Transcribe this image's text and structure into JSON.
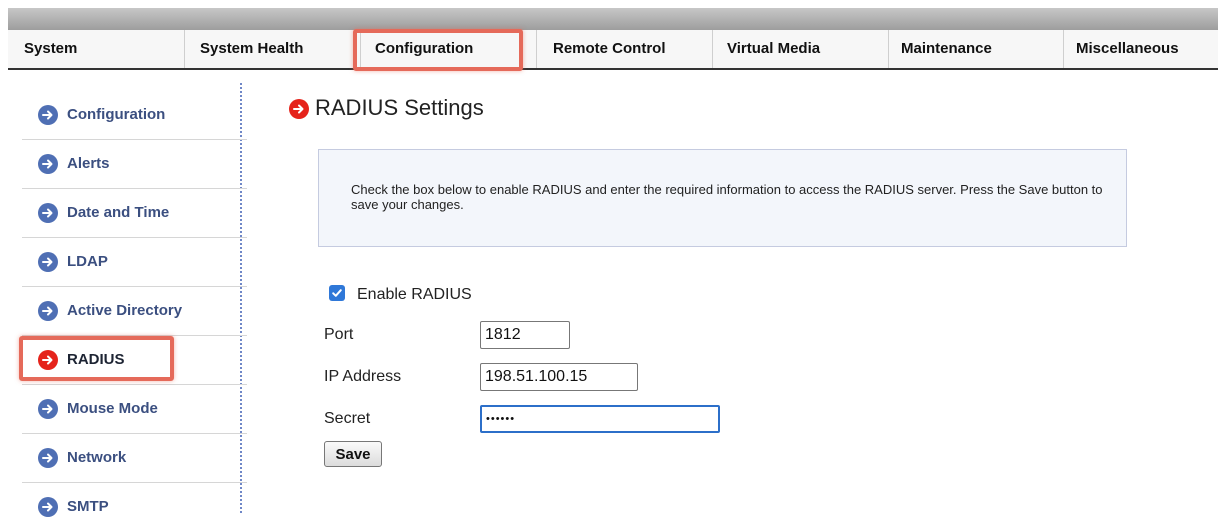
{
  "nav": {
    "items": [
      {
        "label": "System"
      },
      {
        "label": "System Health"
      },
      {
        "label": "Configuration"
      },
      {
        "label": "Remote Control"
      },
      {
        "label": "Virtual Media"
      },
      {
        "label": "Maintenance"
      },
      {
        "label": "Miscellaneous"
      }
    ],
    "active": "Configuration"
  },
  "sidebar": {
    "items": [
      {
        "label": "Configuration",
        "icon": "arrow-right-circle-icon"
      },
      {
        "label": "Alerts",
        "icon": "arrow-right-circle-icon"
      },
      {
        "label": "Date and Time",
        "icon": "arrow-right-circle-icon"
      },
      {
        "label": "LDAP",
        "icon": "arrow-right-circle-icon"
      },
      {
        "label": "Active Directory",
        "icon": "arrow-right-circle-icon"
      },
      {
        "label": "RADIUS",
        "icon": "arrow-right-circle-icon",
        "active": true
      },
      {
        "label": "Mouse Mode",
        "icon": "arrow-right-circle-icon"
      },
      {
        "label": "Network",
        "icon": "arrow-right-circle-icon"
      },
      {
        "label": "SMTP",
        "icon": "arrow-right-circle-icon"
      }
    ]
  },
  "main": {
    "title": "RADIUS Settings",
    "info": "Check the box below to enable RADIUS and enter the required information to access the RADIUS server. Press the Save button to save your changes.",
    "form": {
      "enable_label": "Enable RADIUS",
      "enable_checked": true,
      "port_label": "Port",
      "port_value": "1812",
      "ip_label": "IP Address",
      "ip_value": "198.51.100.15",
      "secret_label": "Secret",
      "secret_value": "••••••",
      "save_label": "Save"
    }
  },
  "colors": {
    "accent_blue": "#4f6fb4",
    "active_red": "#e5231b",
    "highlight": "#e56a5a",
    "checkbox_blue": "#2f78d8"
  }
}
